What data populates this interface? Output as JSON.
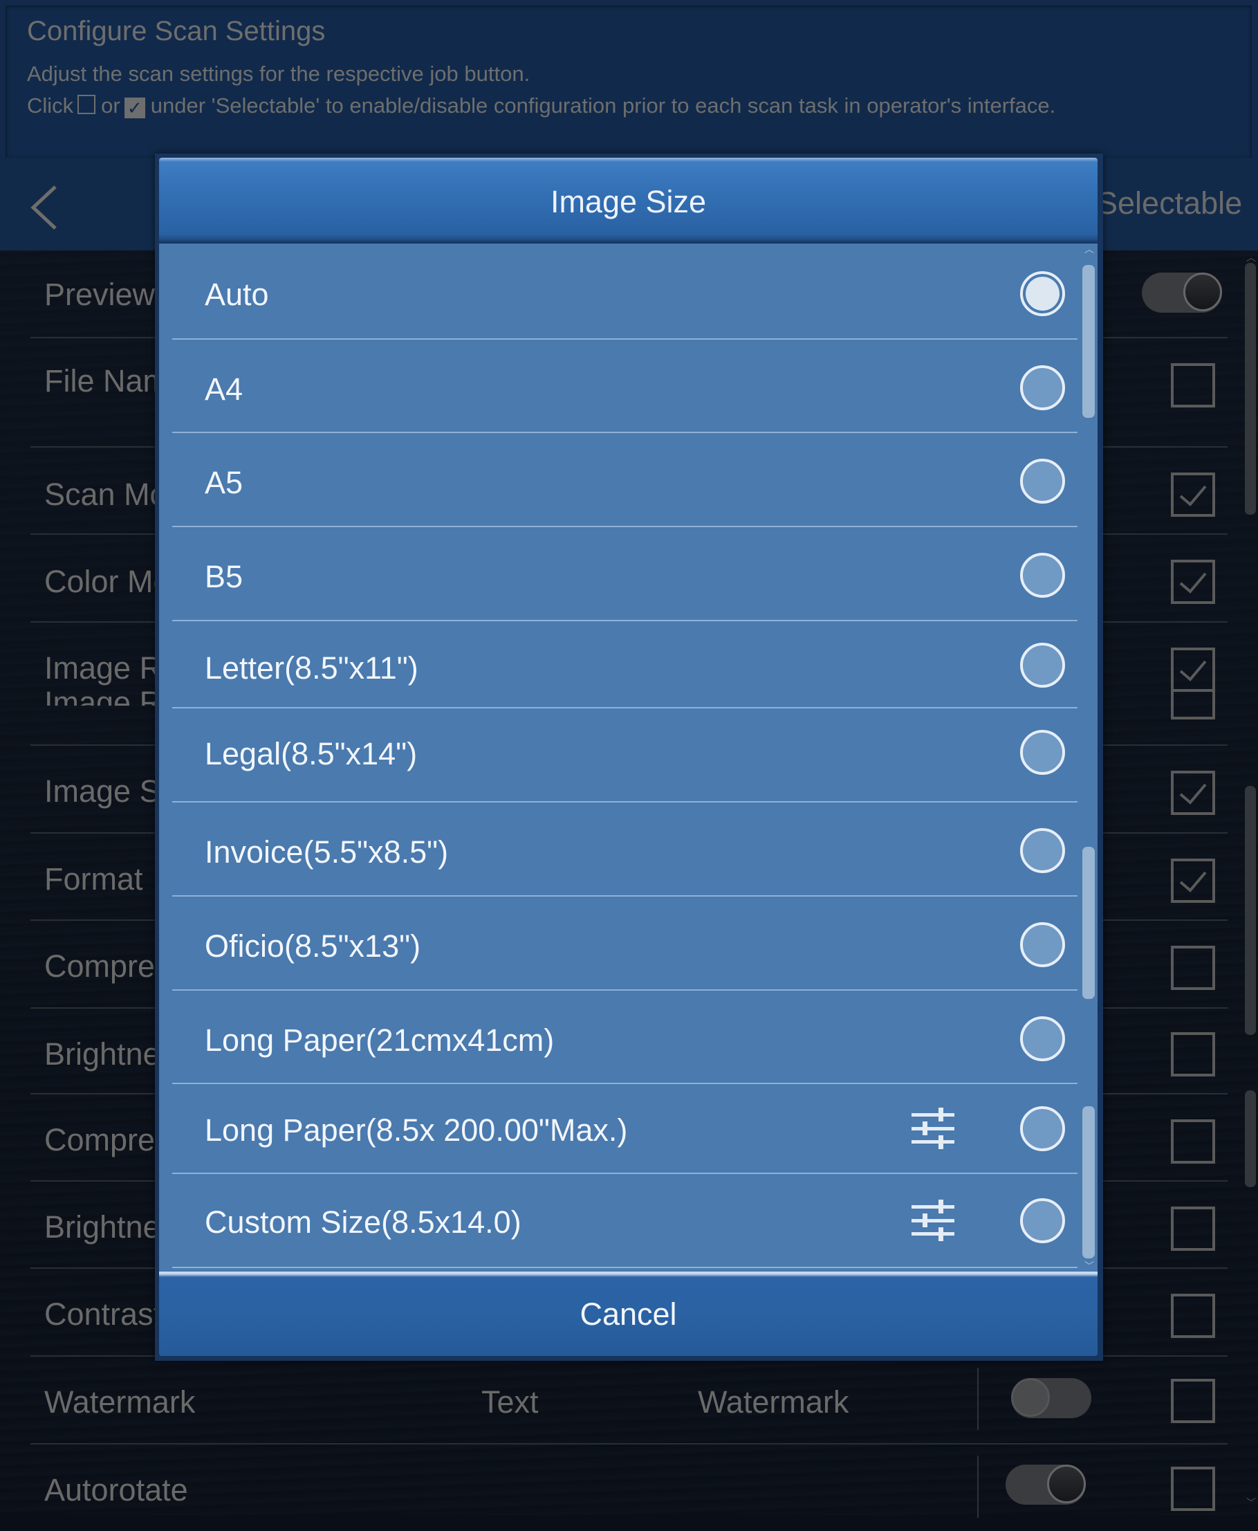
{
  "info": {
    "title": "Configure Scan Settings",
    "line1": "Adjust the scan settings for the respective job button.",
    "line2_prefix": "Click",
    "line2_or": "or",
    "line2_suffix": "under 'Selectable' to enable/disable configuration prior to each scan task in operator's interface."
  },
  "header": {
    "back_icon": "chevron-left-icon",
    "selectable_label": "Selectable"
  },
  "settings": [
    {
      "label": "Preview",
      "control": "toggle",
      "toggle_on": true
    },
    {
      "label": "File Name",
      "selectable": false
    },
    {
      "label": "Scan Mode",
      "selectable": true
    },
    {
      "label": "Color Mode",
      "selectable": true
    },
    {
      "label": "Image Resolution",
      "selectable": true
    },
    {
      "label": "Image Size",
      "selectable": true
    },
    {
      "label": "Format",
      "selectable": true
    },
    {
      "label": "Compression",
      "selectable": false
    },
    {
      "label": "Brightness",
      "selectable": false
    },
    {
      "label": "Compression",
      "selectable": false
    },
    {
      "label": "Brightness",
      "selectable": false
    },
    {
      "label": "Contrast",
      "selectable": false
    },
    {
      "label": "Watermark",
      "value1": "Text",
      "value2": "Watermark",
      "toggle_on": false,
      "selectable": false
    },
    {
      "label": "Autorotate",
      "toggle_on": true,
      "selectable": false
    }
  ],
  "modal": {
    "title": "Image Size",
    "options": [
      {
        "label": "Auto",
        "selected": true,
        "has_settings": false
      },
      {
        "label": "A4",
        "selected": false,
        "has_settings": false
      },
      {
        "label": "A5",
        "selected": false,
        "has_settings": false
      },
      {
        "label": "B5",
        "selected": false,
        "has_settings": false
      },
      {
        "label": "Letter(8.5\"x11\")",
        "selected": false,
        "has_settings": false
      },
      {
        "label": "Legal(8.5\"x14\")",
        "selected": false,
        "has_settings": false
      },
      {
        "label": "Invoice(5.5\"x8.5\")",
        "selected": false,
        "has_settings": false
      },
      {
        "label": "Oficio(8.5\"x13\")",
        "selected": false,
        "has_settings": false
      },
      {
        "label": "Long Paper(21cmx41cm)",
        "selected": false,
        "has_settings": false
      },
      {
        "label": "Long Paper(8.5x 200.00\"Max.)",
        "selected": false,
        "has_settings": true
      },
      {
        "label": "Custom Size(8.5x14.0)",
        "selected": false,
        "has_settings": true
      }
    ],
    "cancel_label": "Cancel"
  },
  "colors": {
    "modal_body": "#4a7aae",
    "modal_header": "#2f6aad",
    "background": "#0a0f17",
    "muted_text": "#6a6a6a"
  }
}
